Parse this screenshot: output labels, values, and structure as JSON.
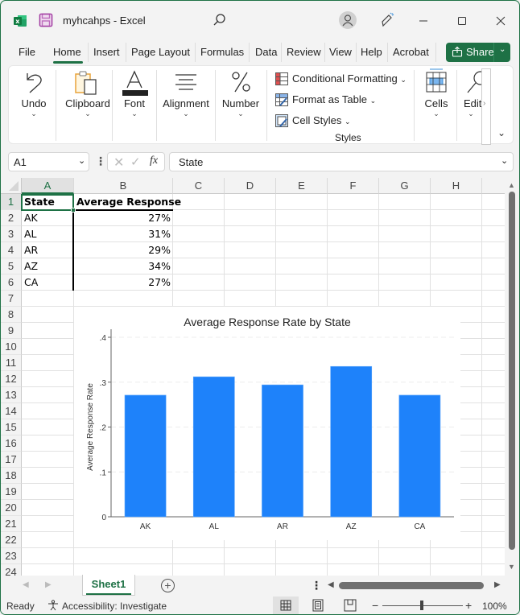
{
  "window": {
    "title": "myhcahps  -  Excel",
    "app_icon": "excel-logo-icon",
    "controls": [
      "minimize-icon",
      "maximize-icon",
      "close-icon"
    ]
  },
  "menu": {
    "tabs": [
      "File",
      "Home",
      "Insert",
      "Page Layout",
      "Formulas",
      "Data",
      "Review",
      "View",
      "Help",
      "Acrobat"
    ],
    "active_tab": "Home",
    "share_label": "Share"
  },
  "ribbon": {
    "groups": [
      {
        "label": "Undo",
        "icon": "undo-icon"
      },
      {
        "label": "Clipboard",
        "icon": "clipboard-icon"
      },
      {
        "label": "Font",
        "icon": "font-icon"
      },
      {
        "label": "Alignment",
        "icon": "alignment-icon"
      },
      {
        "label": "Number",
        "icon": "percent-icon"
      }
    ],
    "styles": {
      "items": [
        "Conditional Formatting",
        "Format as Table",
        "Cell Styles"
      ],
      "group_label": "Styles"
    },
    "cells_label": "Cells",
    "editing_label": "Edit",
    "chevron": "⌄"
  },
  "formula_bar": {
    "name_box": "A1",
    "content": "State",
    "fx": "fx"
  },
  "grid": {
    "columns": [
      "A",
      "B",
      "C",
      "D",
      "E",
      "F",
      "G",
      "H"
    ],
    "rows": [
      "1",
      "2",
      "3",
      "4",
      "5",
      "6",
      "7",
      "8",
      "9",
      "10",
      "11",
      "12",
      "13",
      "14",
      "15",
      "16",
      "17",
      "18",
      "19",
      "20",
      "21",
      "22",
      "23",
      "24"
    ],
    "selected_cell": "A1",
    "cells": {
      "headers": [
        "State",
        "Average Response"
      ],
      "data": [
        {
          "state": "AK",
          "value": "27%"
        },
        {
          "state": "AL",
          "value": "31%"
        },
        {
          "state": "AR",
          "value": "29%"
        },
        {
          "state": "AZ",
          "value": "34%"
        },
        {
          "state": "CA",
          "value": "27%"
        }
      ]
    }
  },
  "chart_data": {
    "type": "bar",
    "title": "Average Response Rate by State",
    "xlabel": "",
    "ylabel": "Average Response Rate",
    "categories": [
      "AK",
      "AL",
      "AR",
      "AZ",
      "CA"
    ],
    "values": [
      0.271,
      0.312,
      0.294,
      0.335,
      0.271
    ],
    "ylim": [
      0,
      0.4
    ],
    "yticks": [
      0,
      0.1,
      0.2,
      0.3,
      0.4
    ],
    "ytick_labels": [
      "0",
      ".1",
      ".2",
      ".3",
      ".4"
    ],
    "grid": true,
    "bar_color": "#1e82fa"
  },
  "sheets": {
    "tabs": [
      "Sheet1"
    ],
    "active": "Sheet1"
  },
  "status": {
    "ready": "Ready",
    "accessibility": "Accessibility: Investigate",
    "zoom": "100%",
    "zoom_fraction": 0.5
  },
  "colors": {
    "accent": "#1e7145"
  }
}
